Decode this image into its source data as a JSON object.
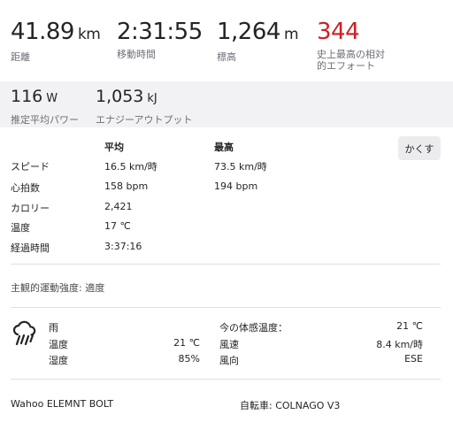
{
  "top_stats": [
    {
      "value": "41.89",
      "unit": "km",
      "label": "距離"
    },
    {
      "value": "2:31:55",
      "unit": "",
      "label": "移動時間"
    },
    {
      "value": "1,264",
      "unit": "m",
      "label": "標高"
    },
    {
      "value": "344",
      "unit": "",
      "label_line1": "史上最高の相対",
      "label_line2": "的エフォート"
    }
  ],
  "band_stats": [
    {
      "value": "116",
      "unit": "W",
      "label": "推定平均パワー"
    },
    {
      "value": "1,053",
      "unit": "kJ",
      "label": "エナジーアウトプット"
    }
  ],
  "details": {
    "col_avg": "平均",
    "col_max": "最高",
    "hide_button": "かくす",
    "rows": [
      {
        "label": "スピード",
        "avg": "16.5 km/時",
        "max": "73.5 km/時"
      },
      {
        "label": "心拍数",
        "avg": "158 bpm",
        "max": "194 bpm"
      },
      {
        "label": "カロリー",
        "avg": "2,421",
        "max": ""
      },
      {
        "label": "温度",
        "avg": "17 ℃",
        "max": ""
      },
      {
        "label": "経過時間",
        "avg": "3:37:16",
        "max": ""
      }
    ]
  },
  "perceived_effort": "主観的運動強度: 適度",
  "weather": {
    "icon": "rain-cloud-icon",
    "condition": "雨",
    "left_rows": [
      {
        "label": "温度",
        "value": "21 ℃"
      },
      {
        "label": "湿度",
        "value": "85%"
      }
    ],
    "right_rows": [
      {
        "label": "今の体感温度：",
        "value": "21 ℃"
      },
      {
        "label": "風速",
        "value": "8.4 km/時"
      },
      {
        "label": "風向",
        "value": "ESE"
      }
    ]
  },
  "device": "Wahoo ELEMNT BOLT",
  "bike": "自転車: COLNAGO V3",
  "colors": {
    "effort": "#cc2127",
    "band": "#f2f2f4"
  }
}
